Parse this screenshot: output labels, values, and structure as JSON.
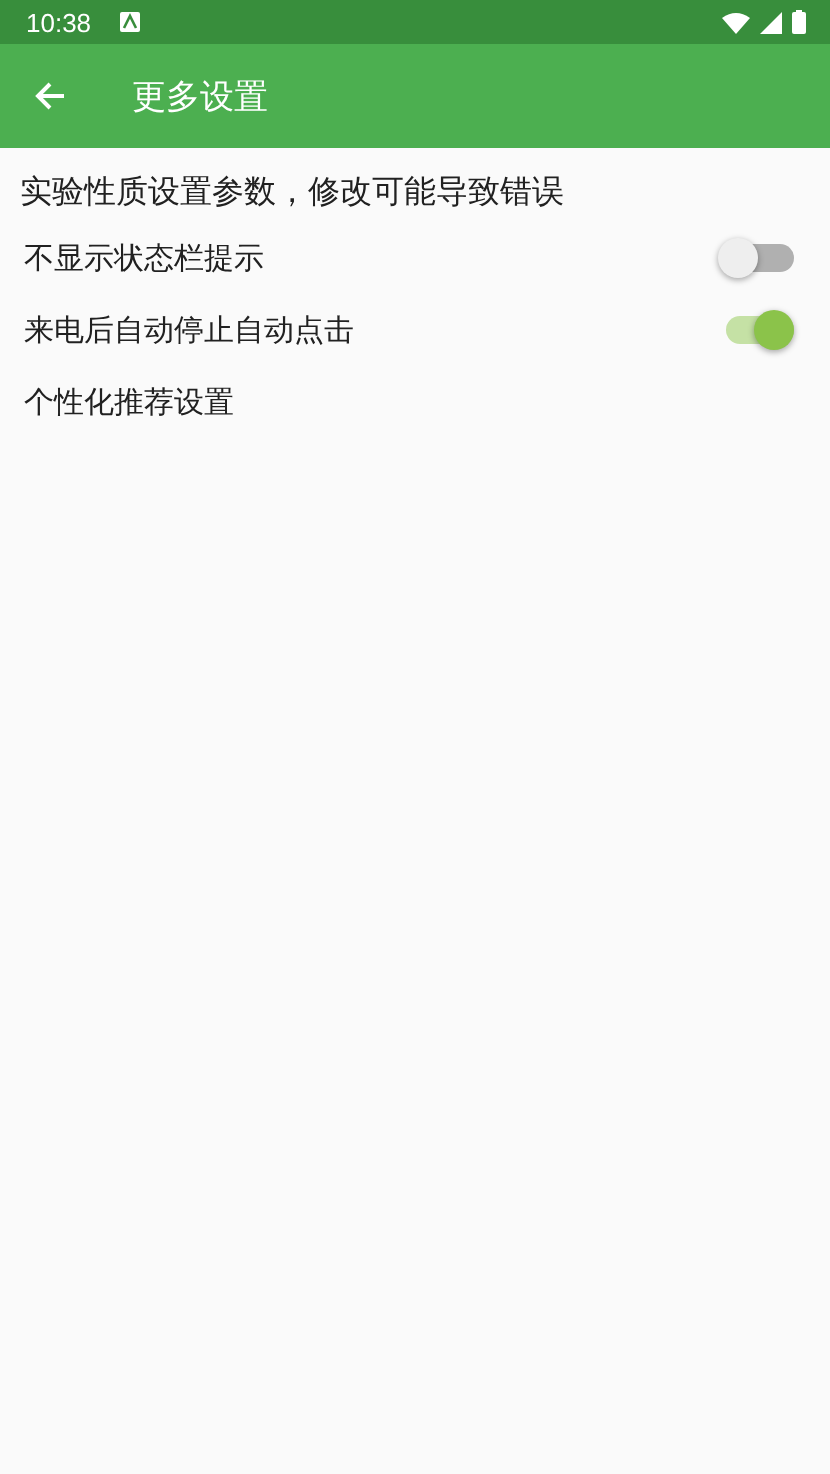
{
  "status_bar": {
    "time": "10:38"
  },
  "app_bar": {
    "title": "更多设置"
  },
  "notice": "实验性质设置参数，修改可能导致错误",
  "settings": [
    {
      "kind": "toggle",
      "label": "不显示状态栏提示",
      "on": false
    },
    {
      "kind": "toggle",
      "label": "来电后自动停止自动点击",
      "on": true
    },
    {
      "kind": "link",
      "label": "个性化推荐设置"
    }
  ]
}
